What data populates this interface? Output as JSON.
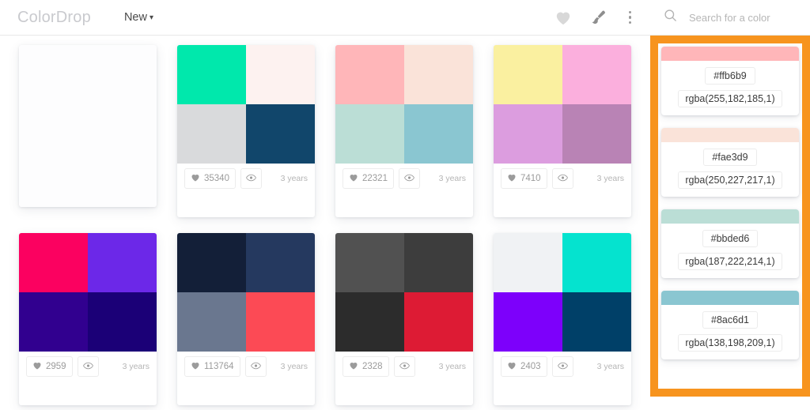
{
  "header": {
    "brand": "ColorDrop",
    "new_menu_label": "New",
    "caret_glyph": "▾",
    "icons": {
      "favorites": "heart-icon",
      "brush": "paintbrush-icon",
      "overflow": "more-vertical-icon"
    }
  },
  "search": {
    "placeholder": "Search for a color",
    "value": "",
    "icon": "search-icon"
  },
  "palettes": [
    {
      "id": "placeholder",
      "empty": true,
      "colors": [],
      "likes": "",
      "age": ""
    },
    {
      "id": "palette-2",
      "empty": false,
      "colors": [
        "#00e8ac",
        "#fdf2f0",
        "#d9dadc",
        "#11466b"
      ],
      "likes": "35340",
      "age": "3 years"
    },
    {
      "id": "palette-3",
      "empty": false,
      "colors": [
        "#ffb6b9",
        "#fae3d9",
        "#bbded6",
        "#8ac6d1"
      ],
      "likes": "22321",
      "age": "3 years"
    },
    {
      "id": "palette-4",
      "empty": false,
      "colors": [
        "#faf0a0",
        "#fbafdd",
        "#dc9ddf",
        "#b983b5"
      ],
      "likes": "7410",
      "age": "3 years"
    },
    {
      "id": "palette-5",
      "empty": false,
      "colors": [
        "#fb0160",
        "#6c28e8",
        "#31008f",
        "#1b0077"
      ],
      "likes": "2959",
      "age": "3 years"
    },
    {
      "id": "palette-6",
      "empty": false,
      "colors": [
        "#131f38",
        "#25395f",
        "#6a778f",
        "#fc4a55"
      ],
      "likes": "113764",
      "age": "3 years"
    },
    {
      "id": "palette-7",
      "empty": false,
      "colors": [
        "#515151",
        "#3d3d3d",
        "#2c2c2c",
        "#dd1b34"
      ],
      "likes": "2328",
      "age": "3 years"
    },
    {
      "id": "palette-8",
      "empty": false,
      "colors": [
        "#f0f2f4",
        "#05e3cf",
        "#7d00fb",
        "#004068"
      ],
      "likes": "2403",
      "age": "3 years"
    }
  ],
  "sidebar": {
    "colors": [
      {
        "swatch": "#ffb6b9",
        "hex": "#ffb6b9",
        "rgba": "rgba(255,182,185,1)"
      },
      {
        "swatch": "#fae3d9",
        "hex": "#fae3d9",
        "rgba": "rgba(250,227,217,1)"
      },
      {
        "swatch": "#bbded6",
        "hex": "#bbded6",
        "rgba": "rgba(187,222,214,1)"
      },
      {
        "swatch": "#8ac6d1",
        "hex": "#8ac6d1",
        "rgba": "rgba(138,198,209,1)"
      }
    ]
  },
  "annotation": {
    "color": "#f7941e",
    "target": "color-detail-sidebar"
  }
}
